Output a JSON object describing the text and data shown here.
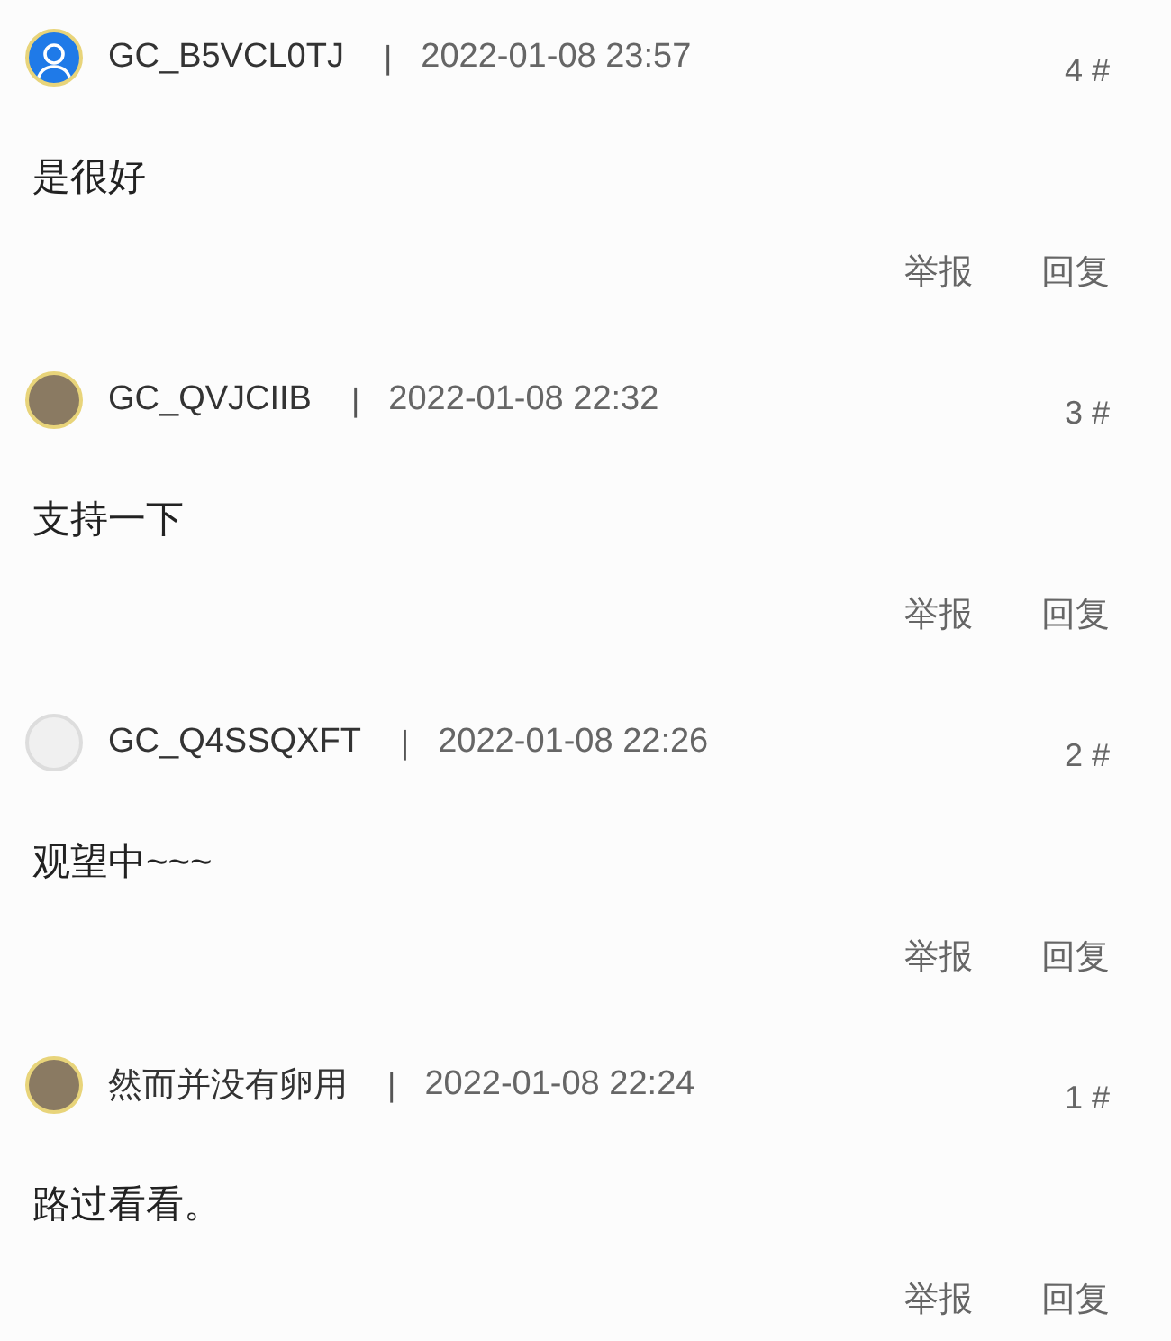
{
  "comments": [
    {
      "avatar": {
        "kind": "default"
      },
      "user": "GC_B5VCL0TJ",
      "separator": "|",
      "time": "2022-01-08 23:57",
      "floor": "4 #",
      "text": "是很好",
      "actions": [
        "举报",
        "回复"
      ]
    },
    {
      "avatar": {
        "kind": "photo"
      },
      "user": "GC_QVJCIIB",
      "separator": "|",
      "time": "2022-01-08 22:32",
      "floor": "3 #",
      "text": "支持一下",
      "actions": [
        "举报",
        "回复"
      ]
    },
    {
      "avatar": {
        "kind": "drawing"
      },
      "user": "GC_Q4SSQXFT",
      "separator": "|",
      "time": "2022-01-08 22:26",
      "floor": "2 #",
      "text": "观望中~~~",
      "actions": [
        "举报",
        "回复"
      ]
    },
    {
      "avatar": {
        "kind": "photo"
      },
      "user": "然而并没有卵用",
      "separator": "|",
      "time": "2022-01-08 22:24",
      "floor": "1 #",
      "text": "路过看看。",
      "actions": [
        "举报",
        "回复"
      ]
    }
  ]
}
